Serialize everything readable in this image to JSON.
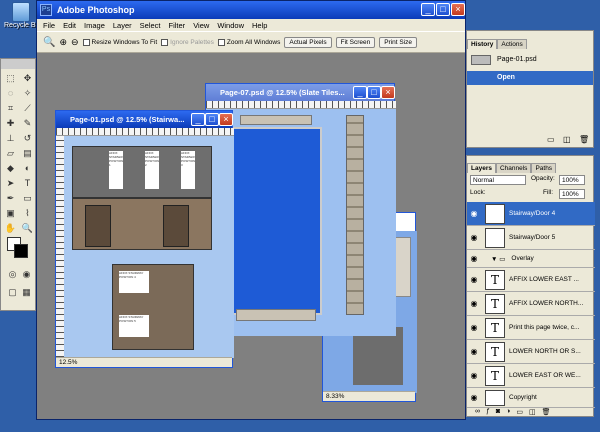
{
  "desktop": {
    "recycle_label": "Recycle Bin"
  },
  "app": {
    "title": "Adobe Photoshop",
    "menu": [
      "File",
      "Edit",
      "Image",
      "Layer",
      "Select",
      "Filter",
      "View",
      "Window",
      "Help"
    ],
    "options": {
      "resize_windows": "Resize Windows To Fit",
      "ignore_palettes": "Ignore Palettes",
      "zoom_all": "Zoom All Windows",
      "actual_pixels": "Actual Pixels",
      "fit_screen": "Fit Screen",
      "print_size": "Print Size"
    }
  },
  "docs": {
    "page07": {
      "title": "Page-07.psd @ 12.5% (Slate Tiles..."
    },
    "page01": {
      "title": "Page-01.psd @ 12.5% (Stairwa...",
      "zoom": "12.5%",
      "labels": [
        "AFFIX STAIRWAY POSITION 1",
        "AFFIX STAIRWAY POSITION 2",
        "AFFIX STAIRWAY POSITION 3",
        "AFFIX STAIRWAY POSITION 4",
        "AFFIX STAIRWAY POSITION 5"
      ]
    },
    "back": {
      "zoom": "8.33%"
    }
  },
  "history": {
    "tabs": [
      "History",
      "Actions"
    ],
    "snapshot": "Page-01.psd",
    "state": "Open"
  },
  "layers": {
    "tabs": [
      "Layers",
      "Channels",
      "Paths"
    ],
    "blend_mode": "Normal",
    "opacity_label": "Opacity:",
    "opacity": "100%",
    "lock_label": "Lock:",
    "fill_label": "Fill:",
    "fill": "100%",
    "rows": [
      {
        "name": "Stairway/Door 4",
        "kind": "image",
        "selected": true
      },
      {
        "name": "Stairway/Door 5",
        "kind": "image",
        "selected": false
      },
      {
        "name": "Overlay",
        "kind": "folder",
        "selected": false
      },
      {
        "name": "AFFIX LOWER EAST ...",
        "kind": "text",
        "selected": false
      },
      {
        "name": "AFFIX LOWER NORTH...",
        "kind": "text",
        "selected": false
      },
      {
        "name": "Print this page twice, c...",
        "kind": "text",
        "selected": false
      },
      {
        "name": "LOWER NORTH OR S...",
        "kind": "text",
        "selected": false
      },
      {
        "name": "LOWER EAST OR WE...",
        "kind": "text",
        "selected": false
      },
      {
        "name": "Copyright",
        "kind": "image",
        "selected": false
      }
    ]
  }
}
